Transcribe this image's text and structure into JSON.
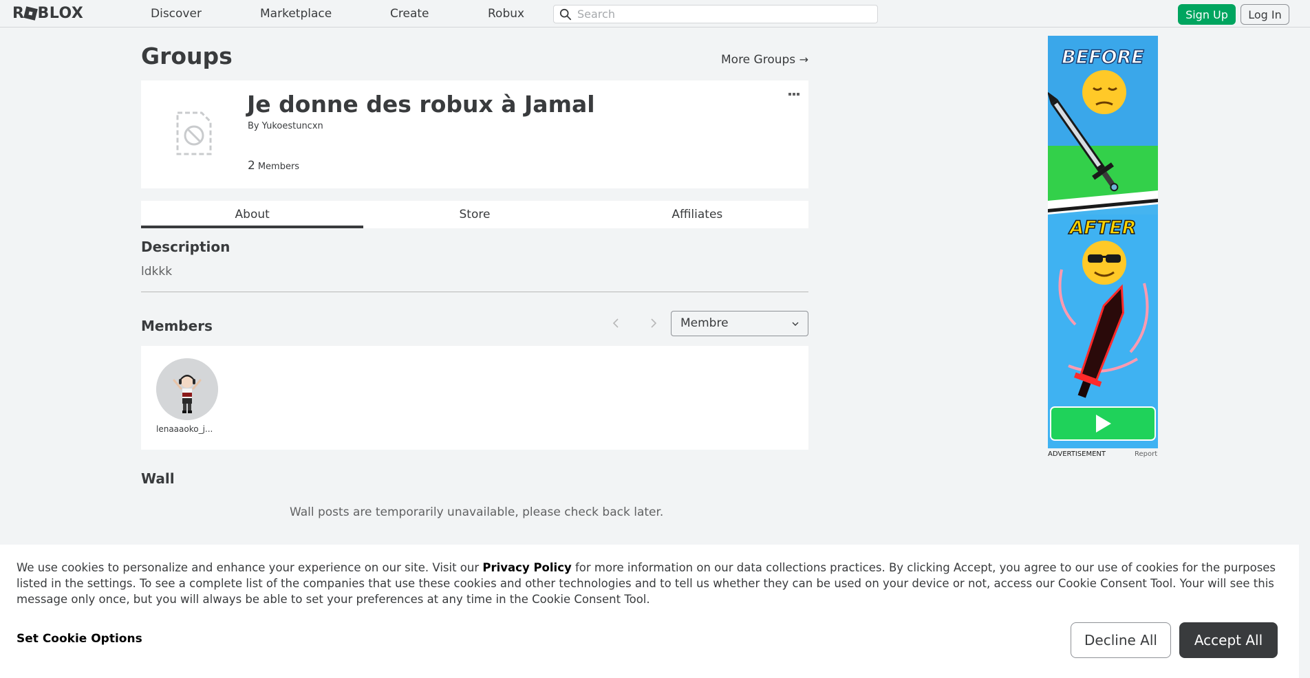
{
  "nav": {
    "logo_text_before": "R",
    "logo_text_after": "BLOX",
    "links": [
      "Discover",
      "Marketplace",
      "Create",
      "Robux"
    ],
    "search_placeholder": "Search",
    "signup_label": "Sign Up",
    "login_label": "Log In"
  },
  "page": {
    "title": "Groups",
    "more_groups_label": "More Groups",
    "more_groups_arrow": "→"
  },
  "group": {
    "name": "Je donne des robux à Jamal",
    "owner_prefix": "By",
    "owner_name": "Yukoestuncxn",
    "member_count": "2",
    "member_count_label": "Members"
  },
  "tabs": [
    "About",
    "Store",
    "Affiliates"
  ],
  "active_tab": "About",
  "about": {
    "description_heading": "Description",
    "description_text": "ldkkk",
    "members_heading": "Members",
    "role_selected": "Membre",
    "members": [
      {
        "name": "lenaaaoko_j..."
      }
    ],
    "wall_heading": "Wall",
    "wall_message": "Wall posts are temporarily unavailable, please check back later."
  },
  "ad": {
    "before_text": "BEFORE",
    "after_text": "AFTER",
    "label": "ADVERTISEMENT",
    "report_label": "Report"
  },
  "cookie": {
    "text_before_link": "We use cookies to personalize and enhance your experience on our site. Visit our ",
    "policy_link": "Privacy Policy",
    "text_after_link": " for more information on our data collections practices. By clicking Accept, you agree to our use of cookies for the purposes listed in the settings. To see a complete list of the companies that use these cookies and other technologies and to tell us whether they can be used on your device or not, access our Cookie Consent Tool. Your will see this message only once, but you will always be able to set your preferences at any time in the Cookie Consent Tool.",
    "set_options_label": "Set Cookie Options",
    "decline_label": "Decline All",
    "accept_label": "Accept All"
  },
  "colors": {
    "brand_green": "#00a55f",
    "text_dark": "#393b3d",
    "page_bg": "#f2f4f5",
    "ad_sky": "#45b4f0"
  },
  "icons": [
    "search-icon",
    "arrow-right-icon",
    "more-dots-icon",
    "chevron-left-icon",
    "chevron-right-icon",
    "chevron-down-icon",
    "blocked-image-icon",
    "play-icon"
  ]
}
